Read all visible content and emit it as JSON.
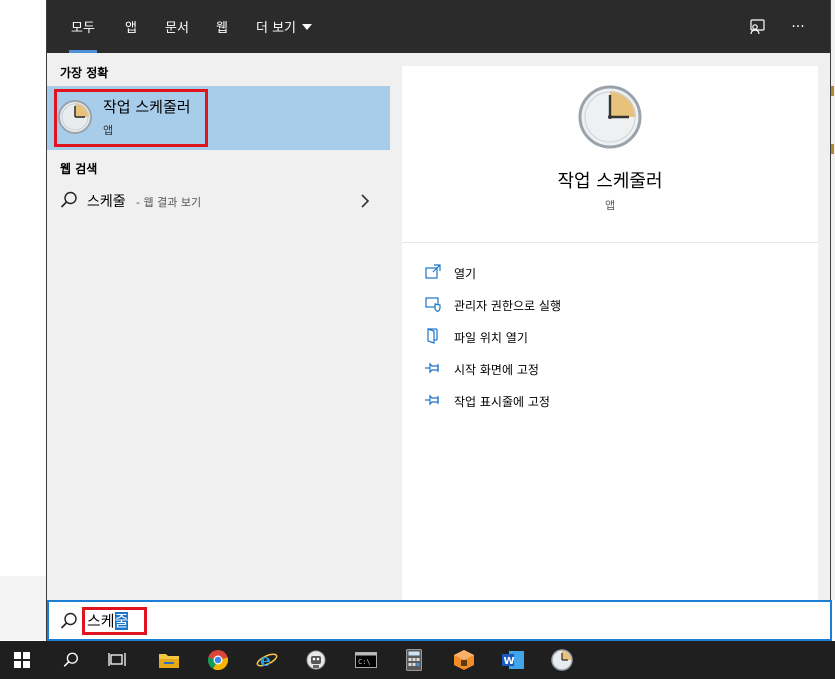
{
  "tabs": [
    {
      "label": "모두",
      "active": true
    },
    {
      "label": "앱"
    },
    {
      "label": "문서"
    },
    {
      "label": "웹"
    },
    {
      "label": "더 보기"
    }
  ],
  "top_actions": {
    "feedback_icon": "feedback-icon",
    "more_label": "···"
  },
  "left": {
    "best_match_heading": "가장 정확",
    "best_match": {
      "name": "작업 스케줄러",
      "type": "앱",
      "icon": "clock-icon"
    },
    "web_search_heading": "웹 검색",
    "web_result": {
      "term": "스케줄",
      "suffix": "- 웹 결과 보기"
    }
  },
  "right": {
    "title": "작업 스케줄러",
    "type": "앱",
    "actions": [
      {
        "label": "열기",
        "icon": "open-icon"
      },
      {
        "label": "관리자 권한으로 실행",
        "icon": "admin-shield-icon"
      },
      {
        "label": "파일 위치 열기",
        "icon": "file-location-icon"
      },
      {
        "label": "시작 화면에 고정",
        "icon": "pin-icon"
      },
      {
        "label": "작업 표시줄에 고정",
        "icon": "pin-icon"
      }
    ]
  },
  "search": {
    "typed": "스케",
    "selected": "줄"
  },
  "taskbar": [
    {
      "name": "start-windows-icon"
    },
    {
      "name": "search-icon"
    },
    {
      "name": "task-view-icon"
    },
    {
      "name": "file-explorer-icon"
    },
    {
      "name": "chrome-icon"
    },
    {
      "name": "internet-explorer-icon"
    },
    {
      "name": "robot-app-icon"
    },
    {
      "name": "terminal-icon"
    },
    {
      "name": "calculator-icon"
    },
    {
      "name": "package-icon"
    },
    {
      "name": "word-icon"
    },
    {
      "name": "task-scheduler-icon"
    }
  ],
  "colors": {
    "accent": "#1a7fd4",
    "highlight": "#a8cdea",
    "topbar": "#2b2b2b",
    "annotation": "#e0141e"
  }
}
